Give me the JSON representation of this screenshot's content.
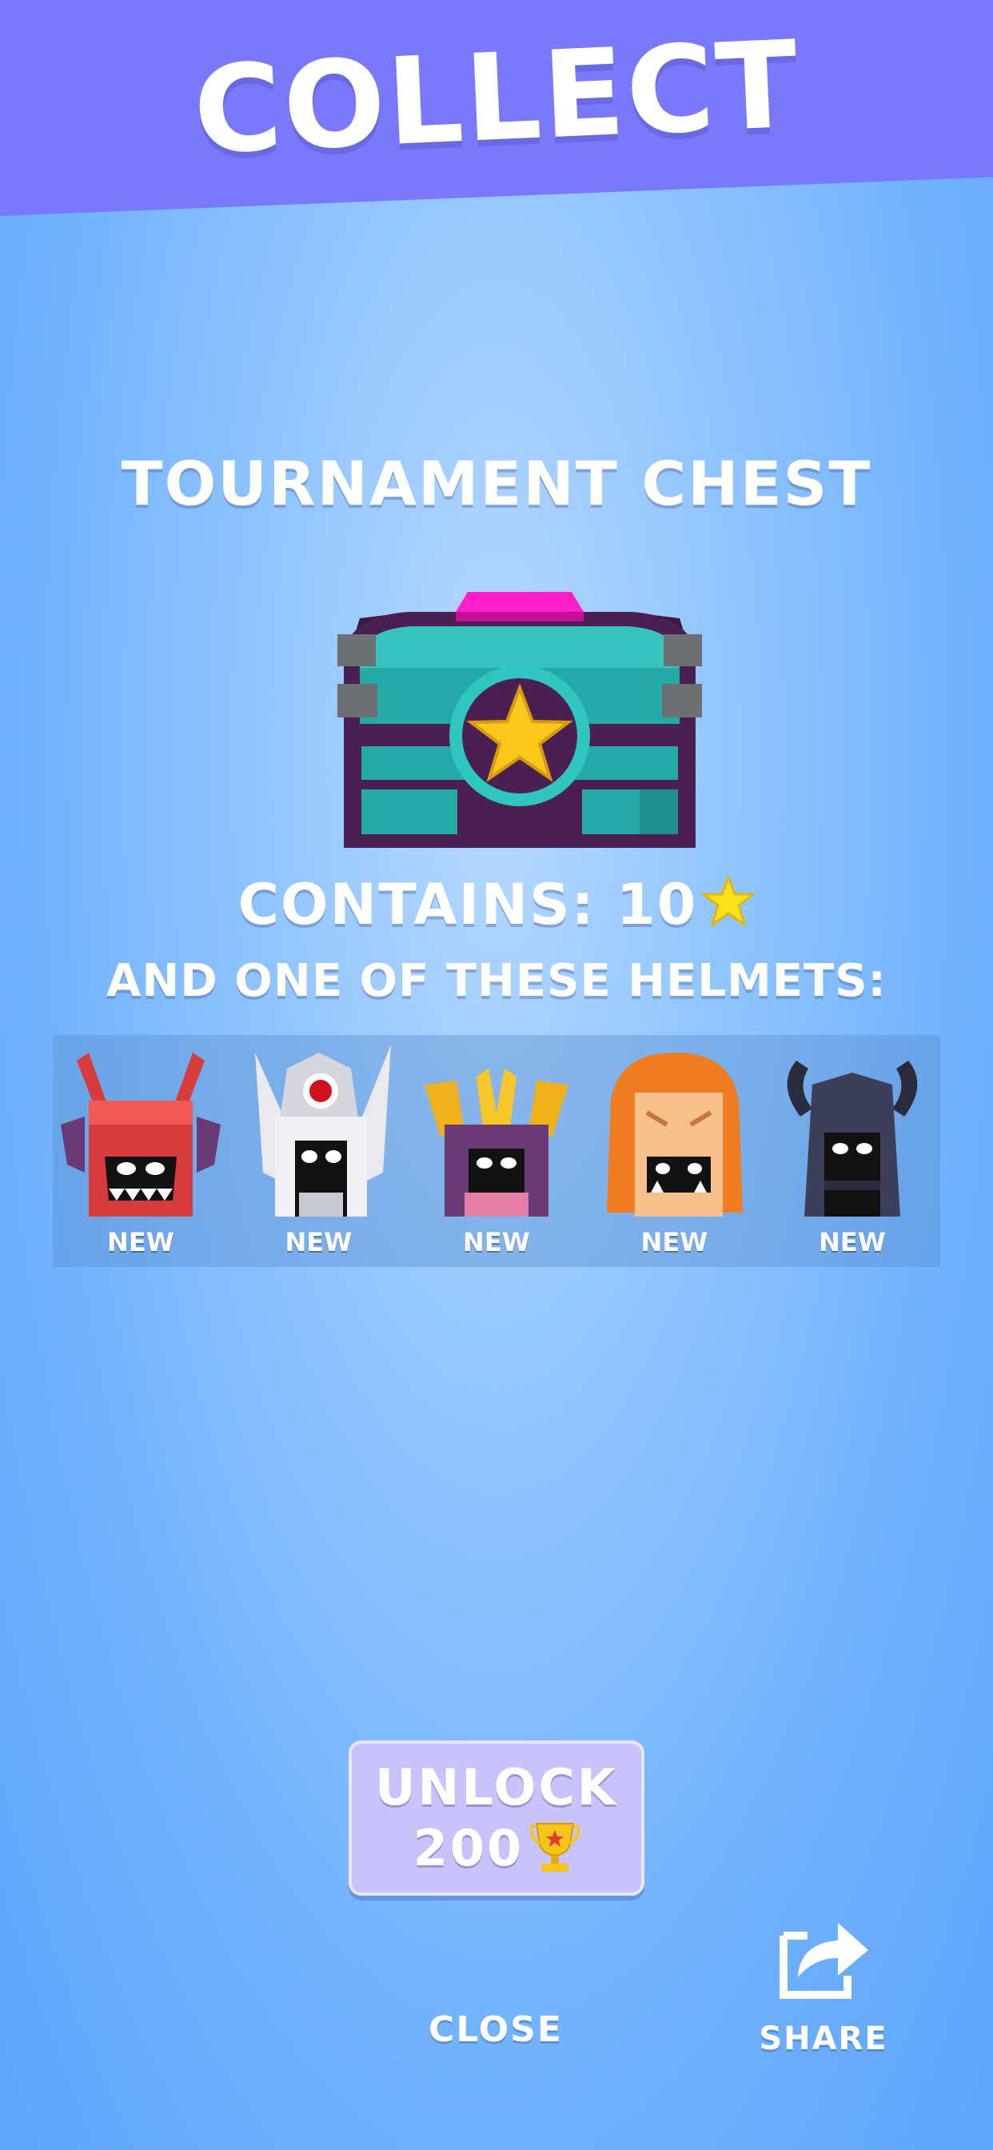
{
  "banner": {
    "title": "COLLECT"
  },
  "chest": {
    "title": "TOURNAMENT CHEST",
    "contains_label": "CONTAINS: 10",
    "helmets_label": "AND ONE OF THESE HELMETS:"
  },
  "helmets": [
    {
      "icon": "red-demon-helmet-icon",
      "badge": "NEW"
    },
    {
      "icon": "white-knight-helmet-icon",
      "badge": "NEW"
    },
    {
      "icon": "gold-crown-helmet-icon",
      "badge": "NEW"
    },
    {
      "icon": "lion-helmet-icon",
      "badge": "NEW"
    },
    {
      "icon": "dark-horned-helmet-icon",
      "badge": "NEW"
    }
  ],
  "unlock": {
    "label": "UNLOCK",
    "price": "200",
    "currency_icon": "trophy-icon"
  },
  "footer": {
    "close_label": "CLOSE",
    "share_label": "SHARE",
    "share_icon": "share-icon"
  },
  "colors": {
    "banner": "#7a78fb",
    "background": "#6eb0fd",
    "button": "#c9c3fb",
    "chest_teal": "#25a9a7",
    "chest_purple": "#4a1f52",
    "gem": "#ff1fc8",
    "star": "#f9c81b"
  }
}
